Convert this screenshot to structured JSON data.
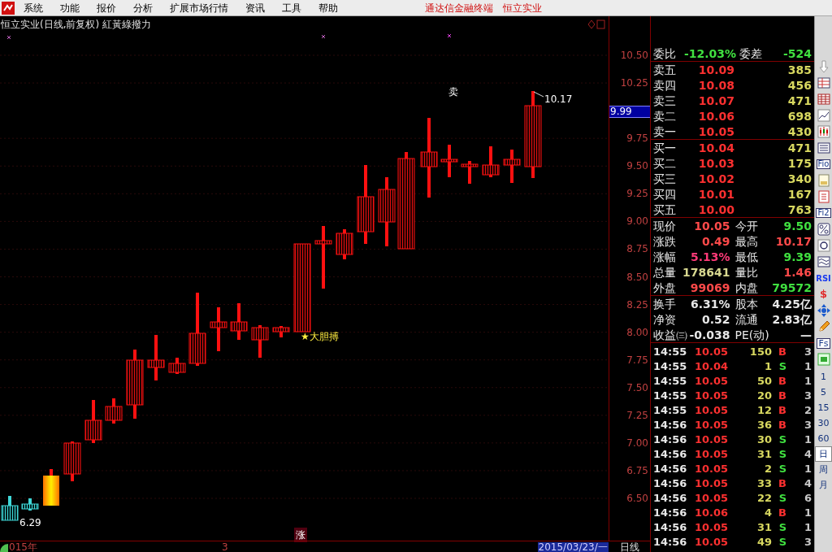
{
  "menu": {
    "items": [
      "系统",
      "功能",
      "报价",
      "分析",
      "扩展市场行情",
      "资讯",
      "工具",
      "帮助"
    ],
    "right": [
      "通达信金融终端",
      "恒立实业"
    ]
  },
  "chart": {
    "title": "恒立实业(日线,前复权) 紅黃綠撥力",
    "y_ticks": [
      "10.50",
      "10.25",
      "9.75",
      "9.50",
      "9.25",
      "9.00",
      "8.75",
      "8.50",
      "8.25",
      "8.00",
      "7.75",
      "7.50",
      "7.25",
      "7.00",
      "6.75",
      "6.50"
    ],
    "current_price": "9.99",
    "sell_signal": "卖",
    "high_label": "10.17",
    "buy_signal": "★大胆搏",
    "low_label": "6.29",
    "marker": "涨"
  },
  "bottom": {
    "year": "015年",
    "month": "3",
    "date": "2015/03/23/一",
    "period": "日线"
  },
  "order_book": {
    "ratio": {
      "label": "委比",
      "value": "-12.03%",
      "diff_label": "委差",
      "diff": "-524"
    },
    "asks": [
      {
        "label": "卖五",
        "price": "10.09",
        "volume": "385"
      },
      {
        "label": "卖四",
        "price": "10.08",
        "volume": "456"
      },
      {
        "label": "卖三",
        "price": "10.07",
        "volume": "471"
      },
      {
        "label": "卖二",
        "price": "10.06",
        "volume": "698"
      },
      {
        "label": "卖一",
        "price": "10.05",
        "volume": "430"
      }
    ],
    "bids": [
      {
        "label": "买一",
        "price": "10.04",
        "volume": "471"
      },
      {
        "label": "买二",
        "price": "10.03",
        "volume": "175"
      },
      {
        "label": "买三",
        "price": "10.02",
        "volume": "340"
      },
      {
        "label": "买四",
        "price": "10.01",
        "volume": "167"
      },
      {
        "label": "买五",
        "price": "10.00",
        "volume": "763"
      }
    ]
  },
  "quote": [
    [
      {
        "label": "现价",
        "value": "10.05",
        "color": "#ff4a4a"
      },
      {
        "label": "今开",
        "value": "9.50",
        "color": "#40e040"
      }
    ],
    [
      {
        "label": "涨跌",
        "value": "0.49",
        "color": "#ff4a4a"
      },
      {
        "label": "最高",
        "value": "10.17",
        "color": "#ff4a4a"
      }
    ],
    [
      {
        "label": "涨幅",
        "value": "5.13%",
        "color": "#ff3a78"
      },
      {
        "label": "最低",
        "value": "9.39",
        "color": "#40e040"
      }
    ],
    [
      {
        "label": "总量",
        "value": "178641",
        "color": "#d8d890"
      },
      {
        "label": "量比",
        "value": "1.46",
        "color": "#ff4a4a"
      }
    ],
    [
      {
        "label": "外盘",
        "value": "99069",
        "color": "#ff4a4a"
      },
      {
        "label": "内盘",
        "value": "79572",
        "color": "#40e040"
      }
    ]
  ],
  "fundamentals": [
    [
      {
        "label": "换手",
        "value": "6.31%"
      },
      {
        "label": "股本",
        "value": "4.25亿"
      }
    ],
    [
      {
        "label": "净资",
        "value": "0.52"
      },
      {
        "label": "流通",
        "value": "2.83亿"
      }
    ],
    [
      {
        "label": "收益㈢",
        "value": "-0.038"
      },
      {
        "label": "PE(动)",
        "value": "—"
      }
    ]
  ],
  "trades": [
    {
      "time": "14:55",
      "price": "10.05",
      "volume": "150",
      "side": "B",
      "kind": "buy",
      "count": "3"
    },
    {
      "time": "14:55",
      "price": "10.04",
      "volume": "1",
      "side": "S",
      "kind": "sell",
      "count": "1"
    },
    {
      "time": "14:55",
      "price": "10.05",
      "volume": "50",
      "side": "B",
      "kind": "buy",
      "count": "1"
    },
    {
      "time": "14:55",
      "price": "10.05",
      "volume": "20",
      "side": "B",
      "kind": "buy",
      "count": "3"
    },
    {
      "time": "14:55",
      "price": "10.05",
      "volume": "12",
      "side": "B",
      "kind": "buy",
      "count": "2"
    },
    {
      "time": "14:56",
      "price": "10.05",
      "volume": "36",
      "side": "B",
      "kind": "buy",
      "count": "3"
    },
    {
      "time": "14:56",
      "price": "10.05",
      "volume": "30",
      "side": "S",
      "kind": "sell",
      "count": "1"
    },
    {
      "time": "14:56",
      "price": "10.05",
      "volume": "31",
      "side": "S",
      "kind": "sell",
      "count": "4"
    },
    {
      "time": "14:56",
      "price": "10.05",
      "volume": "2",
      "side": "S",
      "kind": "sell",
      "count": "1"
    },
    {
      "time": "14:56",
      "price": "10.05",
      "volume": "33",
      "side": "B",
      "kind": "buy",
      "count": "4"
    },
    {
      "time": "14:56",
      "price": "10.05",
      "volume": "22",
      "side": "S",
      "kind": "sell",
      "count": "6"
    },
    {
      "time": "14:56",
      "price": "10.06",
      "volume": "4",
      "side": "B",
      "kind": "buy",
      "count": "1"
    },
    {
      "time": "14:56",
      "price": "10.05",
      "volume": "31",
      "side": "S",
      "kind": "sell",
      "count": "1"
    },
    {
      "time": "14:56",
      "price": "10.05",
      "volume": "49",
      "side": "S",
      "kind": "sell",
      "count": "3"
    }
  ],
  "toolbar": {
    "labels": [
      "Fio",
      "Fi2",
      "RSI",
      "$",
      "Fs"
    ],
    "periods": [
      {
        "label": "1",
        "selected": false
      },
      {
        "label": "5",
        "selected": false
      },
      {
        "label": "15",
        "selected": false
      },
      {
        "label": "30",
        "selected": false
      },
      {
        "label": "60",
        "selected": false
      },
      {
        "label": "日",
        "selected": true
      },
      {
        "label": "周",
        "selected": false
      },
      {
        "label": "月",
        "selected": false
      }
    ]
  }
}
